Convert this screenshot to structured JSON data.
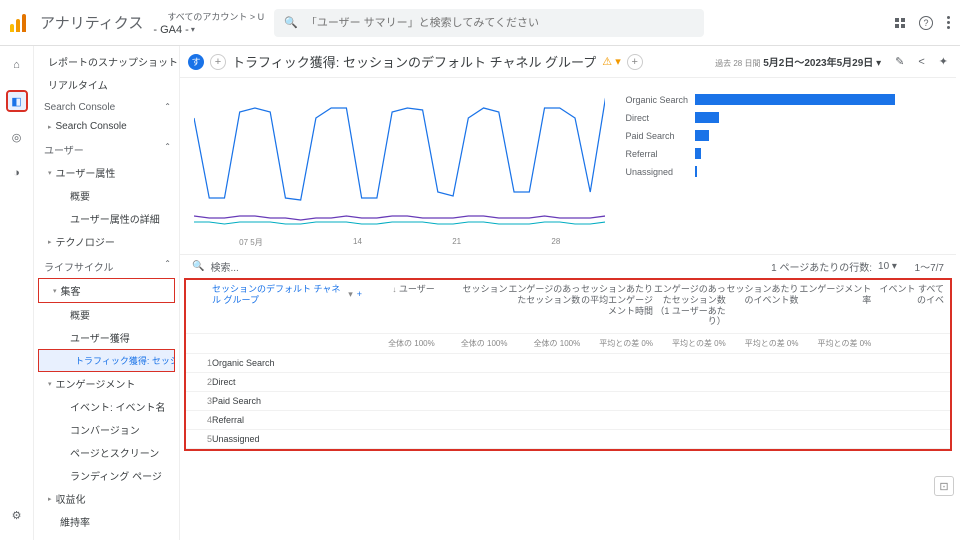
{
  "header": {
    "brand": "アナリティクス",
    "breadcrumb": "すべてのアカウント > U",
    "property": "- GA4 -",
    "search_placeholder": "「ユーザー サマリー」と検索してみてください"
  },
  "sidebar": {
    "items": {
      "snapshot": "レポートのスナップショット",
      "realtime": "リアルタイム",
      "search_console_sec": "Search Console",
      "search_console": "Search Console",
      "user_sec": "ユーザー",
      "user_attr": "ユーザー属性",
      "user_overview": "概要",
      "user_detail": "ユーザー属性の詳細",
      "technology": "テクノロジー",
      "lifecycle_sec": "ライフサイクル",
      "acquisition": "集客",
      "acq_overview": "概要",
      "acq_user": "ユーザー獲得",
      "acq_traffic": "トラフィック獲得: セッショ...",
      "engagement": "エンゲージメント",
      "eng_event": "イベント: イベント名",
      "eng_conv": "コンバージョン",
      "eng_page": "ページとスクリーン",
      "eng_landing": "ランディング ページ",
      "monetization": "収益化",
      "retention": "維持率"
    }
  },
  "page": {
    "title": "トラフィック獲得: セッションのデフォルト チャネル グループ",
    "date_label": "過去 28 日間",
    "date_range": "5月2日～2023年5月29日"
  },
  "chart_data": {
    "line": {
      "type": "line",
      "x_ticks": [
        "07\n5月",
        "14",
        "21",
        "28"
      ],
      "series": [
        {
          "name": "Organic Search",
          "color": "#1a73e8",
          "values": [
            55,
            15,
            15,
            58,
            60,
            58,
            15,
            14,
            55,
            60,
            60,
            15,
            15,
            58,
            60,
            59,
            18,
            16,
            55,
            60,
            58,
            18,
            18,
            60,
            60,
            55,
            18,
            65
          ]
        },
        {
          "name": "Direct",
          "color": "#673ab7",
          "values": [
            6,
            5,
            5,
            6,
            6,
            5,
            5,
            4,
            5,
            5,
            6,
            5,
            5,
            6,
            6,
            5,
            5,
            5,
            6,
            6,
            5,
            5,
            5,
            6,
            5,
            5,
            5,
            6
          ]
        },
        {
          "name": "Paid Search",
          "color": "#00acc1",
          "values": [
            3,
            3,
            2,
            3,
            3,
            3,
            2,
            2,
            3,
            3,
            3,
            2,
            2,
            3,
            3,
            3,
            2,
            2,
            3,
            3,
            2,
            2,
            2,
            3,
            3,
            2,
            2,
            3
          ]
        }
      ]
    },
    "bar": {
      "type": "bar",
      "categories": [
        "Organic Search",
        "Direct",
        "Paid Search",
        "Referral",
        "Unassigned"
      ],
      "values": [
        100,
        12,
        7,
        3,
        1
      ]
    }
  },
  "table": {
    "search": "検索...",
    "rows_label": "1 ページあたりの行数:",
    "rows_per_page": "10",
    "range": "1～7/7",
    "dim_header": "セッションのデフォルト チャネル グループ",
    "columns": [
      "ユーザー",
      "セッション",
      "エンゲージのあったセッション数",
      "セッションあたりの平均エンゲージメント時間",
      "エンゲージのあったセッション数（1 ユーザーあたり）",
      "セッションあたりのイベント数",
      "エンゲージメント率",
      "イベント\nすべてのイベ"
    ],
    "summary": [
      "全体の 100%",
      "全体の 100%",
      "全体の 100%",
      "平均との差 0%",
      "平均との差 0%",
      "平均との差 0%",
      "平均との差 0%",
      ""
    ],
    "rows": [
      {
        "n": "1",
        "dim": "Organic Search"
      },
      {
        "n": "2",
        "dim": "Direct"
      },
      {
        "n": "3",
        "dim": "Paid Search"
      },
      {
        "n": "4",
        "dim": "Referral"
      },
      {
        "n": "5",
        "dim": "Unassigned"
      }
    ]
  }
}
